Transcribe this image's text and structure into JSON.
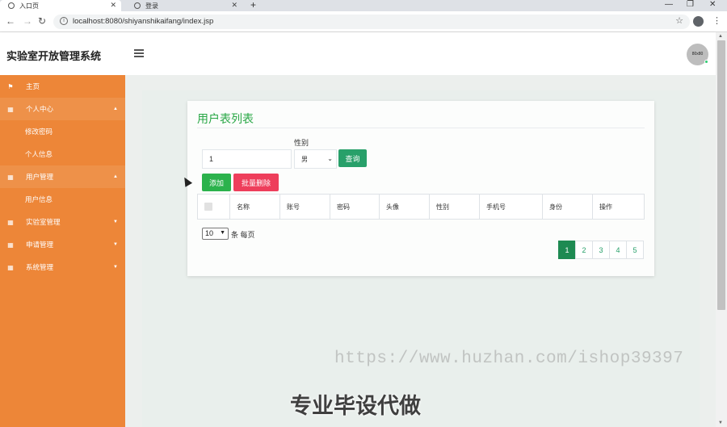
{
  "browser": {
    "tabs": [
      {
        "label": "入口页",
        "active": true
      },
      {
        "label": "登录",
        "active": false
      }
    ],
    "url": "localhost:8080/shiyanshikaifang/index.jsp",
    "icons": {
      "back": "arrow-left-icon",
      "forward": "arrow-right-icon",
      "reload": "reload-icon",
      "bookmark": "star-icon",
      "profile": "account-icon",
      "menu": "kebab-icon"
    }
  },
  "header": {
    "title": "实验室开放管理系统",
    "avatar_text": "80x80"
  },
  "sidebar": {
    "items": [
      {
        "label": "主页",
        "icon": "flag-icon",
        "type": "item"
      },
      {
        "label": "个人中心",
        "icon": "grid-icon",
        "type": "parent",
        "expanded": true
      },
      {
        "label": "修改密码",
        "type": "sub"
      },
      {
        "label": "个人信息",
        "type": "sub"
      },
      {
        "label": "用户管理",
        "icon": "grid-icon",
        "type": "parent",
        "expanded": true
      },
      {
        "label": "用户信息",
        "type": "sub"
      },
      {
        "label": "实验室管理",
        "icon": "grid-icon",
        "type": "item",
        "expanded": false
      },
      {
        "label": "申请管理",
        "icon": "grid-icon",
        "type": "item",
        "expanded": false
      },
      {
        "label": "系统管理",
        "icon": "grid-icon",
        "type": "item",
        "expanded": false
      }
    ]
  },
  "main": {
    "card_title": "用户表列表",
    "search": {
      "input_value": "1",
      "gender_label": "性别",
      "gender_selected": "男",
      "query_label": "查询"
    },
    "actions": {
      "add_label": "添加",
      "batch_delete_label": "批量删除"
    },
    "table": {
      "columns": [
        "名称",
        "账号",
        "密码",
        "头像",
        "性别",
        "手机号",
        "身份",
        "操作"
      ]
    },
    "pagination": {
      "page_size": "10",
      "per_page_label": "条 每页",
      "pages": [
        "1",
        "2",
        "3",
        "4",
        "5"
      ],
      "current_page": "1"
    }
  },
  "overlays": {
    "watermark": "https://www.huzhan.com/ishop39397",
    "caption": "专业毕设代做"
  },
  "colors": {
    "sidebar": "#ed8638",
    "accent_green": "#28a745",
    "danger": "#ee3e5b",
    "page_active": "#1e8a52"
  }
}
